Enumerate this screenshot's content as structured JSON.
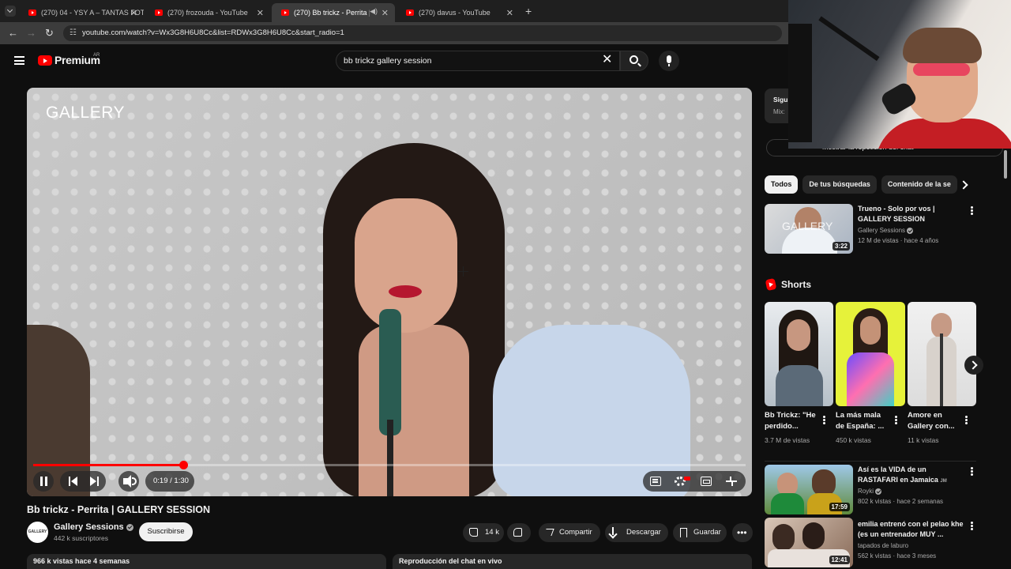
{
  "browser": {
    "tabs": [
      {
        "title": "(270) 04 - YSY A – TANTAS FOT",
        "active": false
      },
      {
        "title": "(270) frozouda - YouTube",
        "active": false
      },
      {
        "title": "(270) Bb trickz - Perrita | GA",
        "active": true
      },
      {
        "title": "(270) davus - YouTube",
        "active": false
      }
    ],
    "url": "youtube.com/watch?v=Wx3G8H6U8Cc&list=RDWx3G8H6U8Cc&start_radio=1"
  },
  "header": {
    "brand": "Premium",
    "country": "AR",
    "search_value": "bb trickz gallery session"
  },
  "player": {
    "watermark": "GALLERY",
    "time": "0:19 / 1:30",
    "progress_fraction": 0.211
  },
  "video": {
    "title": "Bb trickz - Perrita | GALLERY SESSION",
    "channel": "Gallery Sessions",
    "avatar_text": "GALLERY",
    "subscribers": "442 k suscriptores",
    "subscribe_label": "Suscribirse",
    "likes": "14 k",
    "share_label": "Compartir",
    "download_label": "Descargar",
    "save_label": "Guardar",
    "views_line": "966 k vistas  hace 4 semanas",
    "chat_replay": "Reproducción del chat en vivo"
  },
  "sidebar": {
    "mix_card": {
      "title": "Sigu",
      "subtitle": "Mix:"
    },
    "chat_toggle": "Mostrar la repetición del chat",
    "chips": [
      "Todos",
      "De tus búsquedas",
      "Contenido de la se"
    ],
    "top_video": {
      "title": "Trueno - Solo por vos | GALLERY SESSION",
      "channel": "Gallery Sessions",
      "meta": "12 M de vistas · hace 4 años",
      "duration": "3:22",
      "thumb_text": "GALLERY"
    },
    "shorts_label": "Shorts",
    "shorts": [
      {
        "title": "Bb Trickz: \"He perdido...",
        "views": "3.7 M de vistas"
      },
      {
        "title": "La más mala de España: ...",
        "views": "450 k vistas"
      },
      {
        "title": "Amore en Gallery con...",
        "views": "11 k vistas"
      }
    ],
    "videos": [
      {
        "title": "Así es la VIDA de un RASTAFARI en Jamaica",
        "title_suffix": "JM",
        "channel": "Royki",
        "meta": "802 k vistas · hace 2 semanas",
        "duration": "17:59"
      },
      {
        "title": "emilia entrenó con el pelao khe (es un entrenador MUY ...",
        "channel": "tapados de laburo",
        "meta": "562 k vistas · hace 3 meses",
        "duration": "12:41"
      }
    ]
  },
  "colors": {
    "accent": "#ff0000",
    "background": "#0f0f0f",
    "chip_bg": "#272727"
  }
}
